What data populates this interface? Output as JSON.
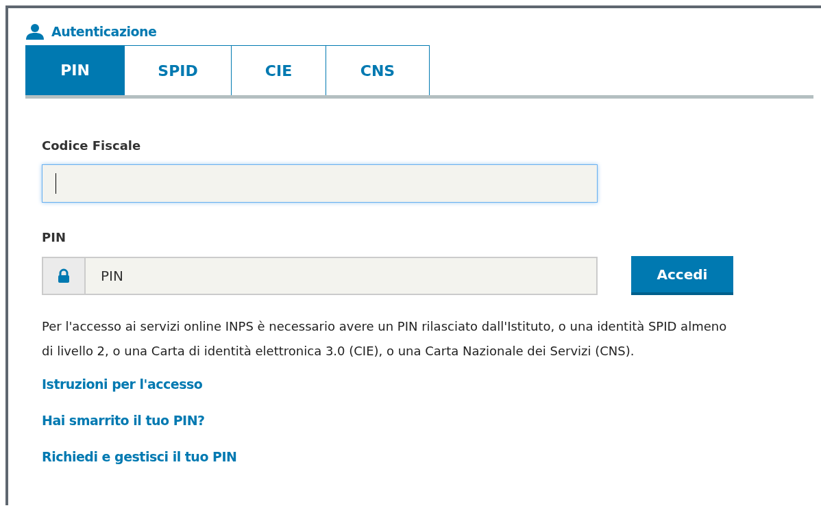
{
  "panel": {
    "title": "Autenticazione"
  },
  "tabs": [
    {
      "label": "PIN",
      "selected": true
    },
    {
      "label": "SPID",
      "selected": false
    },
    {
      "label": "CIE",
      "selected": false
    },
    {
      "label": "CNS",
      "selected": false
    }
  ],
  "fields": [
    {
      "kind": "plain",
      "label": "Codice Fiscale",
      "focused": true
    },
    {
      "kind": "lock",
      "label": "PIN",
      "placeholder": "PIN",
      "focused": false
    }
  ],
  "submit_button": "Accedi",
  "info_text": "Per l'accesso ai servizi online INPS è necessario avere un PIN rilasciato dall'Istituto, o una identità SPID almeno di livello 2, o una Carta di identità elettronica 3.0 (CIE), o una Carta Nazionale dei Servizi (CNS).",
  "links": [
    "Istruzioni per l'accesso",
    "Hai smarrito il tuo PIN?",
    "Richiedi e gestisci il tuo PIN"
  ]
}
